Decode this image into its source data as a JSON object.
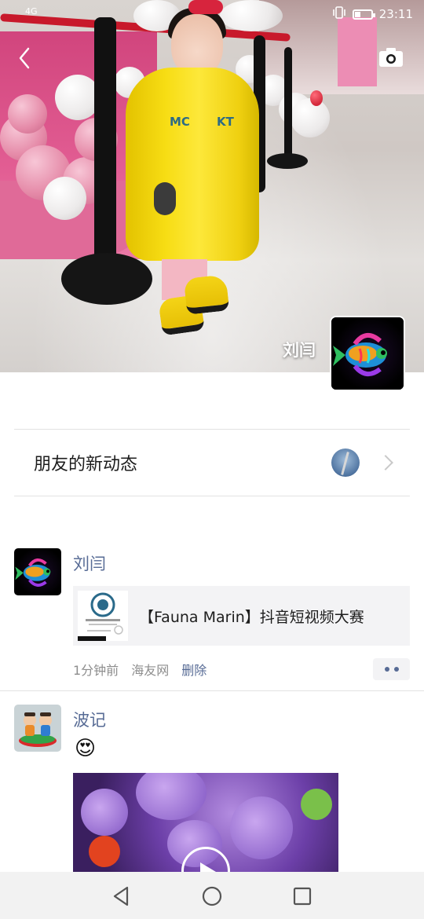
{
  "status_bar": {
    "network": "4G",
    "time": "23:11",
    "battery_level": 0.35
  },
  "cover": {
    "owner_name": "刘闫",
    "back_icon": "back-chevron-icon",
    "camera_icon": "camera-icon"
  },
  "friends_updates": {
    "label": "朋友的新动态"
  },
  "posts": [
    {
      "author": "刘闫",
      "link_title": "【Fauna Marin】抖音短视频大赛",
      "time": "1分钟前",
      "source": "海友网",
      "delete_label": "删除"
    },
    {
      "author": "波记",
      "emoji": "😍"
    }
  ],
  "nav": {
    "back_icon": "triangle-back-icon",
    "home_icon": "circle-home-icon",
    "recents_icon": "square-recents-icon"
  },
  "colors": {
    "link_blue": "#576b95",
    "card_bg": "#f3f3f5",
    "nav_bg": "#f2f2f2"
  }
}
